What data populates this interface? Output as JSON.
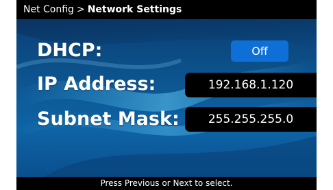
{
  "header": {
    "parent": "Net Config",
    "separator": ">",
    "current": "Network Settings"
  },
  "settings": {
    "dhcp": {
      "label": "DHCP:",
      "value": "Off"
    },
    "ip_address": {
      "label": "IP Address:",
      "value": "192.168.1.120"
    },
    "subnet_mask": {
      "label": "Subnet Mask:",
      "value": "255.255.255.0"
    }
  },
  "footer": {
    "hint": "Press Previous or Next to select."
  },
  "colors": {
    "panel_base": "#0d5894",
    "toggle": "#0e6fd6",
    "field": "#000000",
    "bar": "#000000"
  }
}
